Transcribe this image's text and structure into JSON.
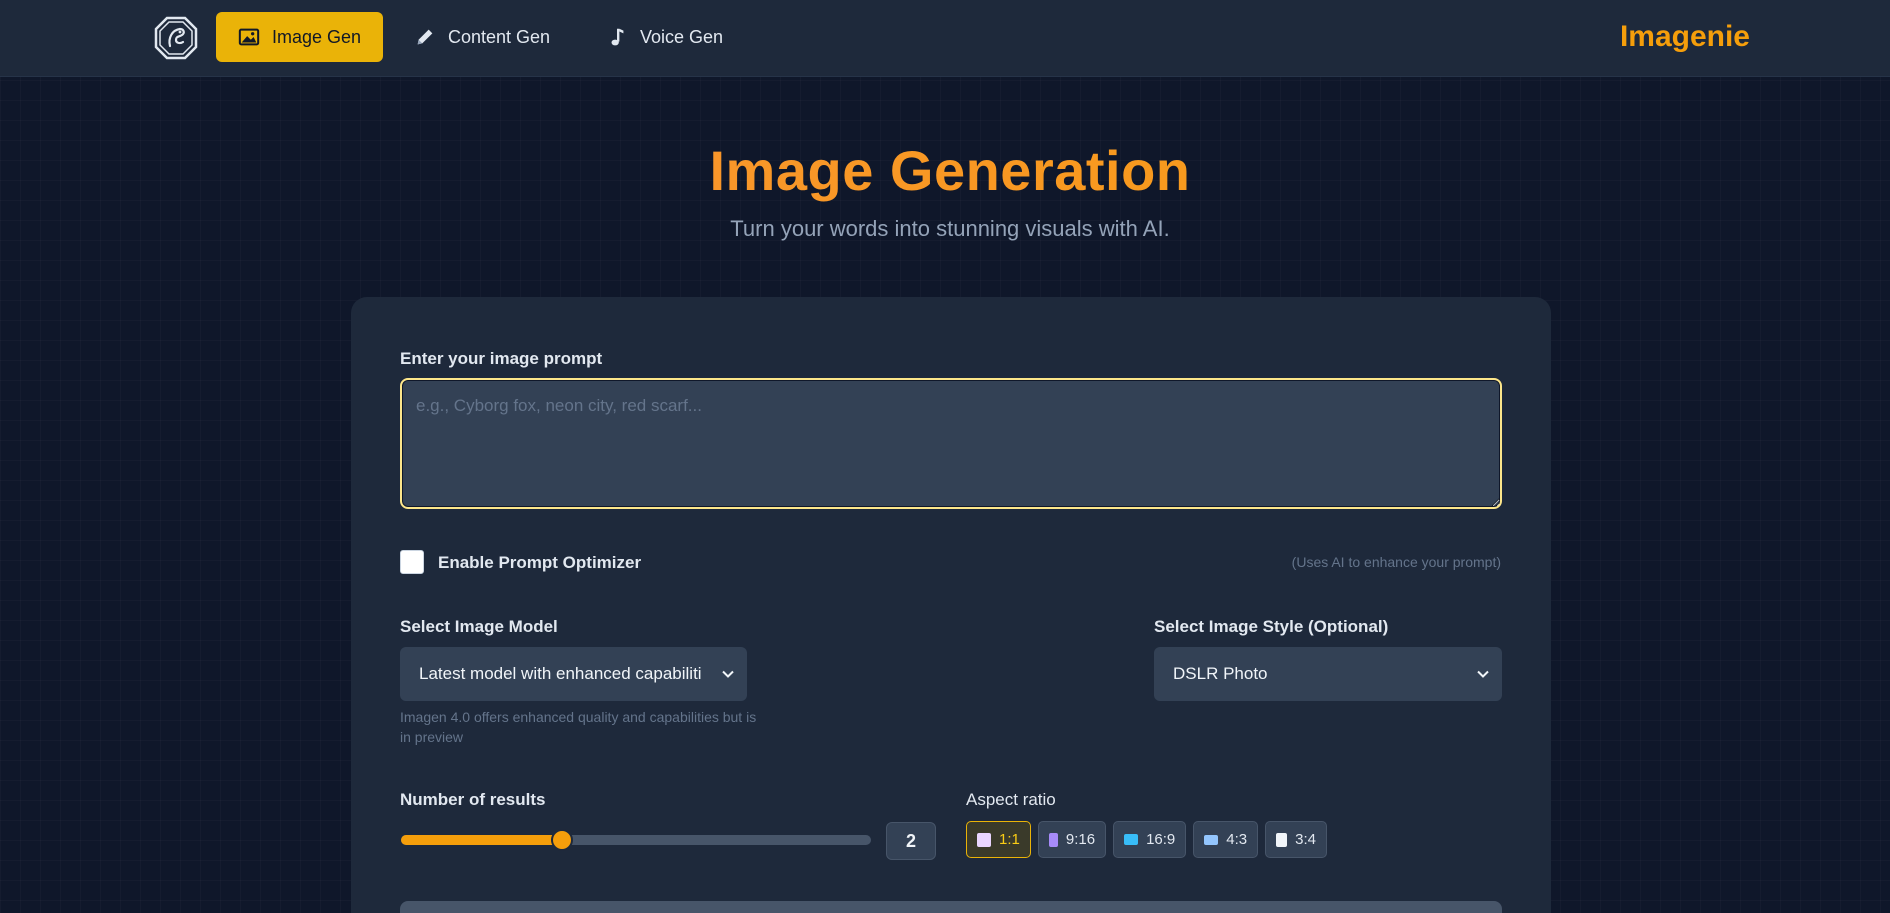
{
  "nav": {
    "items": [
      {
        "label": "Image Gen",
        "icon": "image-icon",
        "active": true
      },
      {
        "label": "Content Gen",
        "icon": "pencil-icon",
        "active": false
      },
      {
        "label": "Voice Gen",
        "icon": "music-note-icon",
        "active": false
      }
    ],
    "brand": "Imagenie"
  },
  "header": {
    "title": "Image Generation",
    "subtitle": "Turn your words into stunning visuals with AI."
  },
  "form": {
    "prompt_label": "Enter your image prompt",
    "prompt_placeholder": "e.g., Cyborg fox, neon city, red scarf...",
    "prompt_value": "",
    "optimizer_label": "Enable Prompt Optimizer",
    "optimizer_checked": false,
    "optimizer_hint": "(Uses AI to enhance your prompt)",
    "model_label": "Select Image Model",
    "model_value": "Latest model with enhanced capabiliti",
    "model_help": "Imagen 4.0 offers enhanced quality and capabilities but is in preview",
    "style_label": "Select Image Style (Optional)",
    "style_value": "DSLR Photo",
    "results_label": "Number of results",
    "results_value": "2",
    "results_fraction": 0.343,
    "aspect_label": "Aspect ratio",
    "aspect_options": [
      {
        "label": "1:1",
        "active": true,
        "icon": "square-icon"
      },
      {
        "label": "9:16",
        "active": false,
        "icon": "phone-icon"
      },
      {
        "label": "16:9",
        "active": false,
        "icon": "monitor-icon"
      },
      {
        "label": "4:3",
        "active": false,
        "icon": "camera-icon"
      },
      {
        "label": "3:4",
        "active": false,
        "icon": "document-icon"
      }
    ]
  },
  "colors": {
    "accent": "#f59e0b",
    "nav_active": "#eab308",
    "background": "#0f172a",
    "card": "#1e293b"
  }
}
